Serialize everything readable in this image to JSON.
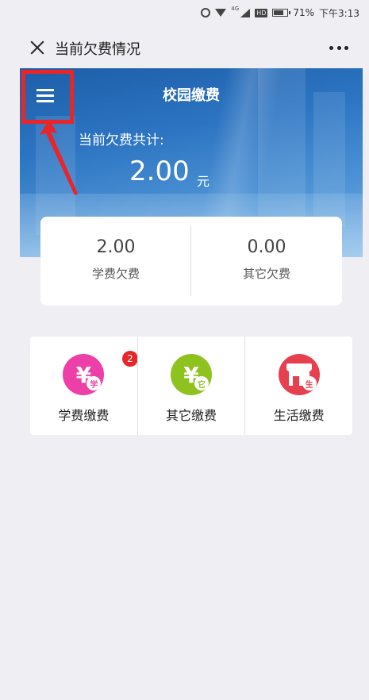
{
  "status_bar": {
    "network": "4G",
    "hd": "HD",
    "battery": "71%",
    "time": "下午3:13"
  },
  "nav": {
    "title": "当前欠费情况"
  },
  "hero": {
    "title": "校园缴费",
    "subtitle": "当前欠费共计:",
    "amount": "2.00",
    "unit": "元"
  },
  "summary": {
    "tuition_value": "2.00",
    "tuition_label": "学费欠费",
    "other_value": "0.00",
    "other_label": "其它欠费"
  },
  "payments": {
    "items": [
      {
        "label": "学费缴费",
        "icon": "yuan-tuition-icon",
        "glyph": "¥",
        "mini": "学",
        "color": "#ec3fa7",
        "badge": "2"
      },
      {
        "label": "其它缴费",
        "icon": "yuan-other-icon",
        "glyph": "¥",
        "mini": "它",
        "color": "#8dc21f"
      },
      {
        "label": "生活缴费",
        "icon": "store-life-icon",
        "mini": "生",
        "color": "#e6404f"
      }
    ]
  },
  "colors": {
    "highlight": "#e8262a",
    "banner": "#2c74c2"
  }
}
